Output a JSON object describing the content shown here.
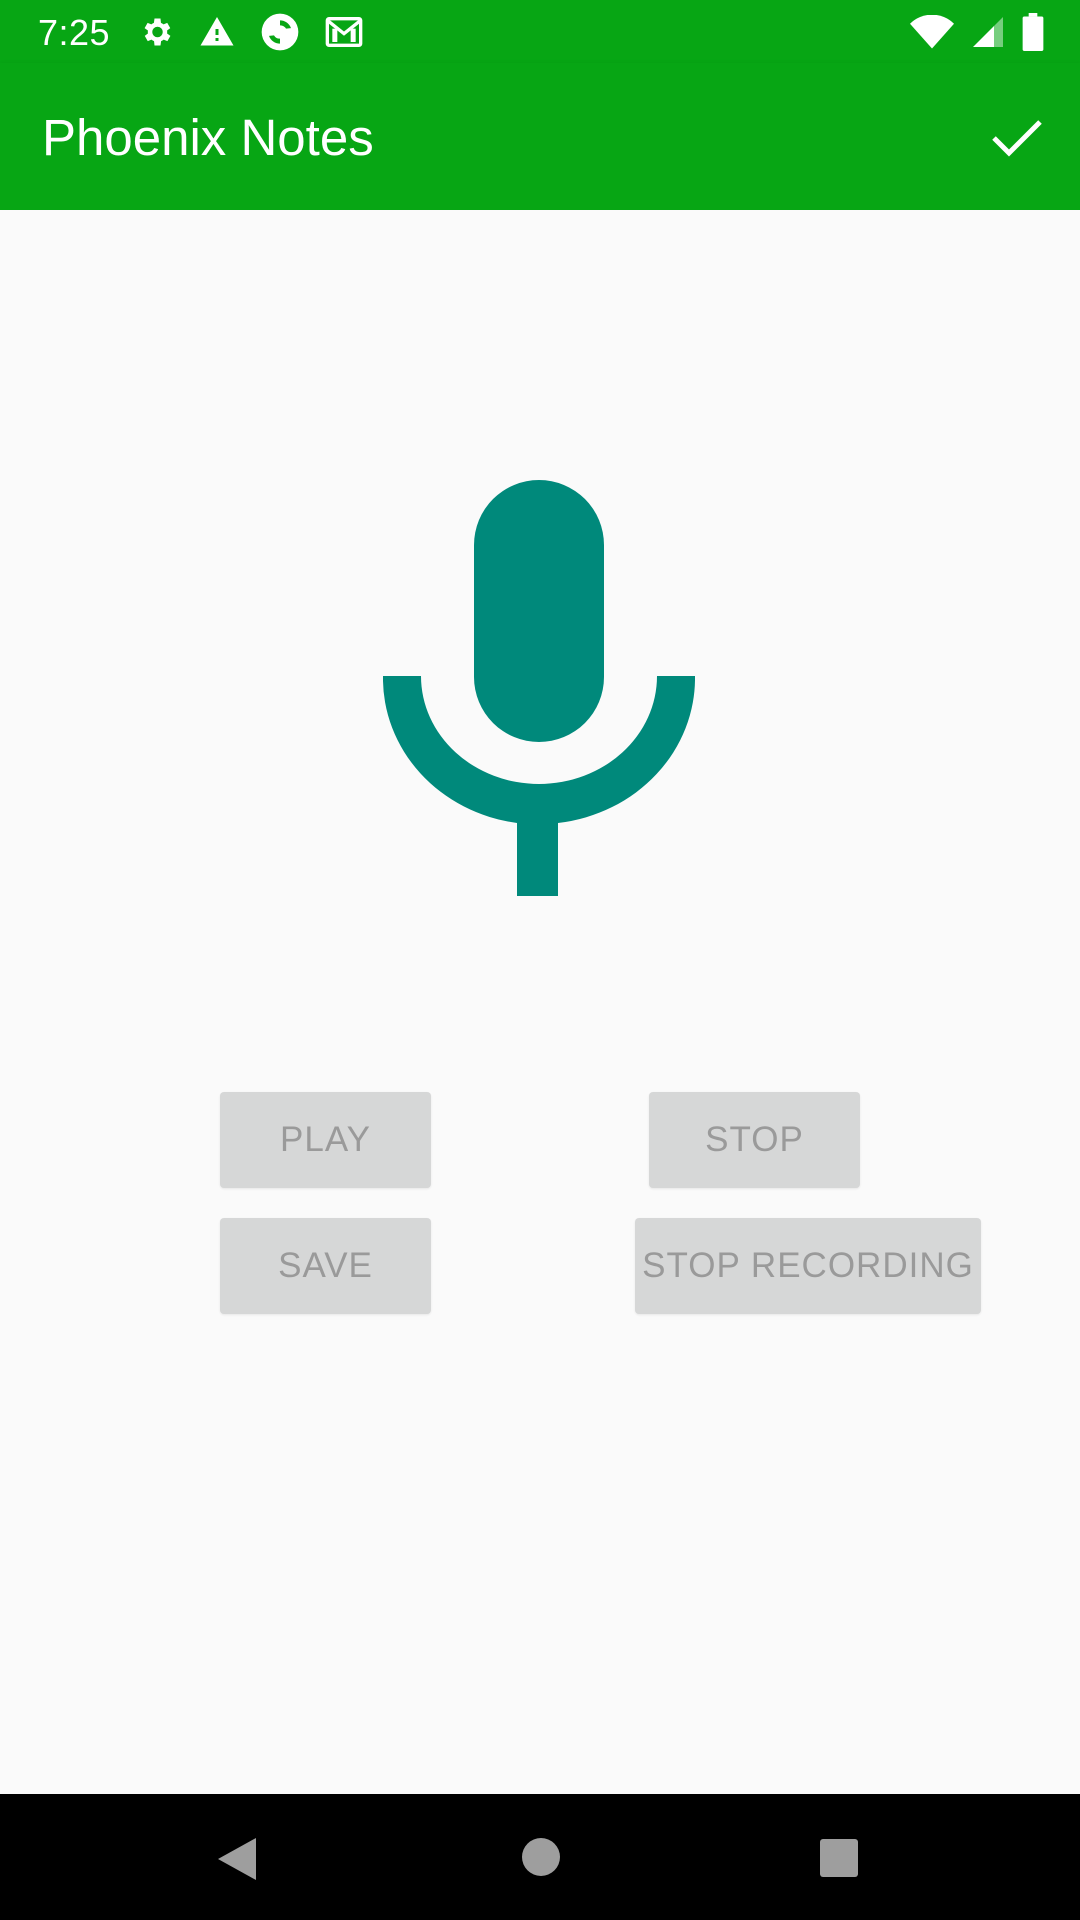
{
  "status_bar": {
    "time": "7:25",
    "icons_left": [
      "gear-icon",
      "warning-icon",
      "sync-app-icon",
      "gmail-icon"
    ],
    "icons_right": [
      "wifi-icon",
      "signal-icon",
      "battery-icon"
    ]
  },
  "app_bar": {
    "title": "Phoenix Notes",
    "action_icon": "check-icon"
  },
  "main": {
    "mic_icon": "microphone-icon",
    "buttons": {
      "play": "PLAY",
      "stop": "STOP",
      "save": "SAVE",
      "stop_recording": "STOP RECORDING"
    }
  },
  "nav_bar": {
    "icons": [
      "back-icon",
      "home-icon",
      "recents-icon"
    ]
  },
  "colors": {
    "app_bar": "#07a614",
    "mic": "#00897b",
    "button_disabled_bg": "#d6d7d7",
    "button_disabled_text": "#9a9a9a",
    "background": "#fafafa"
  }
}
